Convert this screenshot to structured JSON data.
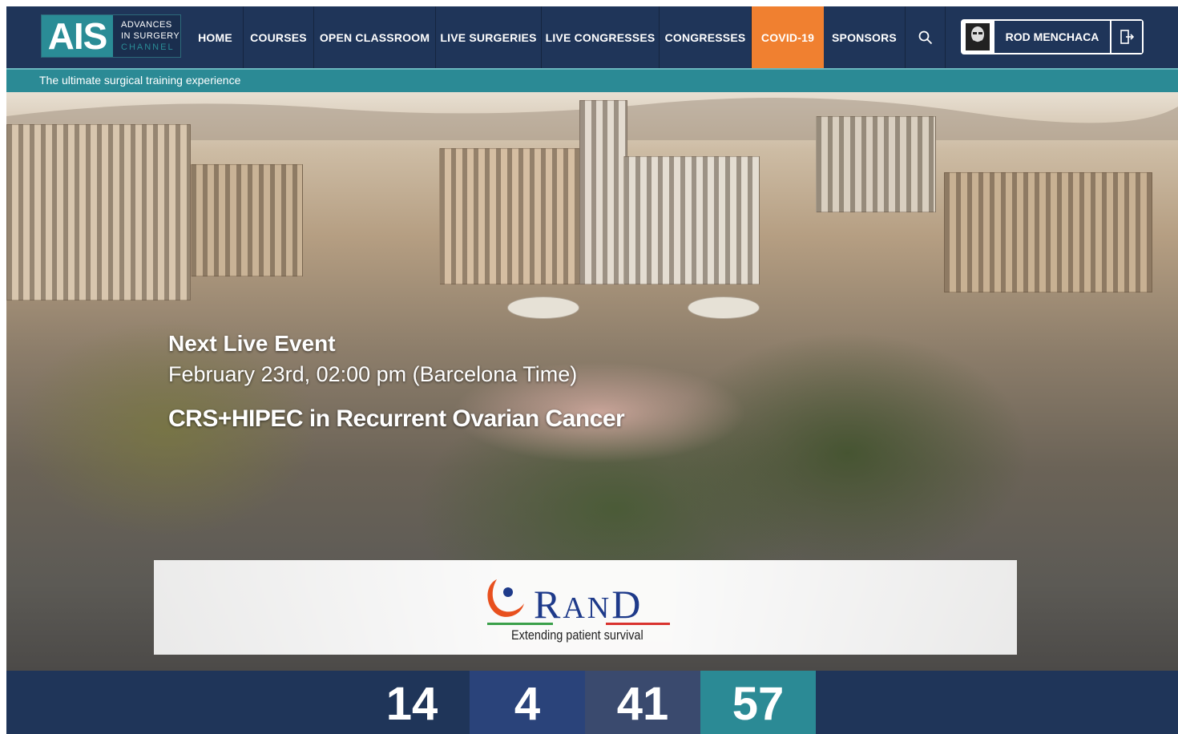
{
  "logo": {
    "mark": "AIS",
    "line1": "ADVANCES",
    "line2": "IN SURGERY",
    "line3": "CHANNEL"
  },
  "nav": {
    "items": [
      {
        "label": "HOME"
      },
      {
        "label": "COURSES"
      },
      {
        "label": "OPEN CLASSROOM"
      },
      {
        "label": "LIVE SURGERIES"
      },
      {
        "label": "LIVE CONGRESSES"
      },
      {
        "label": "CONGRESSES"
      },
      {
        "label": "COVID-19"
      },
      {
        "label": "SPONSORS"
      }
    ],
    "search_icon": "search-icon",
    "covid_color": "#f08030"
  },
  "user": {
    "name": "ROD MENCHACA",
    "avatar_icon": "user-avatar-icon",
    "logout_icon": "logout-icon"
  },
  "tagline": "The ultimate surgical training experience",
  "hero": {
    "heading": "Next Live Event",
    "date": "February 23rd, 02:00 pm (Barcelona Time)",
    "title": "CRS+HIPEC in Recurrent Ovarian Cancer"
  },
  "sponsor": {
    "name_first": "R",
    "name_mid": "AN",
    "name_last": "D",
    "tagline": "Extending patient survival"
  },
  "countdown": [
    "14",
    "4",
    "41",
    "57"
  ],
  "colors": {
    "navy": "#1f3559",
    "teal": "#2b8a95",
    "orange": "#f08030"
  }
}
